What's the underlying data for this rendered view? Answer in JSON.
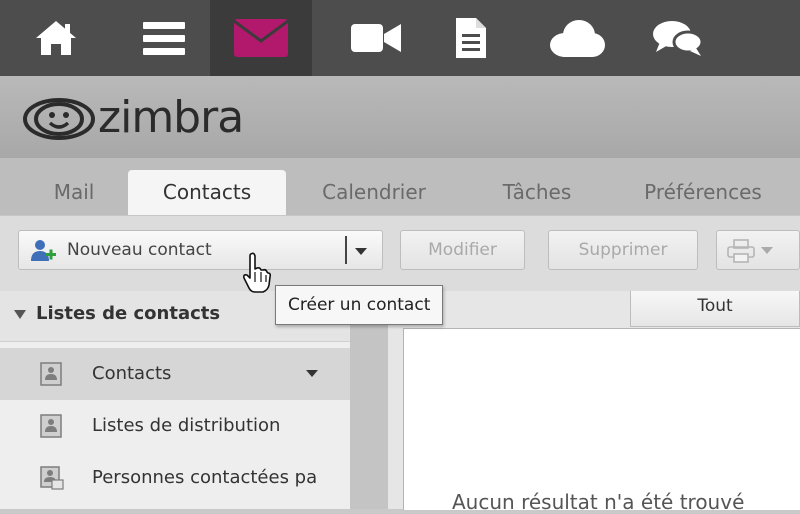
{
  "top_nav": {
    "items": [
      {
        "icon": "home-icon"
      },
      {
        "icon": "menu-icon"
      },
      {
        "icon": "mail-icon",
        "active": true
      },
      {
        "icon": "video-icon"
      },
      {
        "icon": "document-icon"
      },
      {
        "icon": "cloud-icon"
      },
      {
        "icon": "chat-icon"
      }
    ],
    "active_color": "#b2186b",
    "icon_color": "#ffffff"
  },
  "brand": {
    "logo_text": "zimbra"
  },
  "tabs": [
    {
      "label": "Mail"
    },
    {
      "label": "Contacts",
      "active": true
    },
    {
      "label": "Calendrier"
    },
    {
      "label": "Tâches"
    },
    {
      "label": "Préférences"
    }
  ],
  "toolbar": {
    "new_contact_label": "Nouveau contact",
    "edit_label": "Modifier",
    "delete_label": "Supprimer",
    "print_icon": "print-icon"
  },
  "tooltip": {
    "text": "Créer un contact"
  },
  "sidebar": {
    "title": "Listes de contacts",
    "items": [
      {
        "label": "Contacts",
        "selected": true
      },
      {
        "label": "Listes de distribution"
      },
      {
        "label": "Personnes contactées pa"
      }
    ]
  },
  "content": {
    "filter_tab": "Tout",
    "empty_message": "Aucun résultat n'a été trouvé"
  }
}
